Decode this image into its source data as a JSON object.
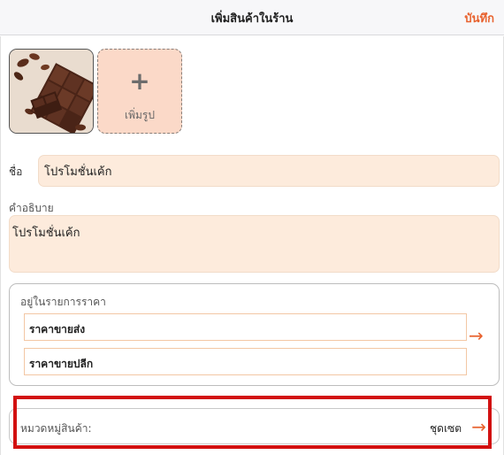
{
  "header": {
    "title": "เพิ่มสินค้าในร้าน",
    "save_label": "บันทึก"
  },
  "photos": {
    "add_label": "เพิ่มรูป",
    "add_symbol": "+"
  },
  "form": {
    "name_label": "ชื่อ",
    "name_value": "โปรโมชั่นเค้ก",
    "description_label": "คำอธิบาย",
    "description_value": "โปรโมชั่นเค้ก"
  },
  "price_list": {
    "title": "อยู่ในรายการราคา",
    "items": [
      {
        "label": "ราคาขายส่ง"
      },
      {
        "label": "ราคาขายปลีก"
      }
    ]
  },
  "category": {
    "label": "หมวดหมู่สินค้า:",
    "value": "ชุดเซต"
  },
  "icons": {
    "arrow": "arrow-right-icon",
    "plus": "plus-icon"
  },
  "colors": {
    "accent": "#e8622e",
    "field_bg": "#fdebdc",
    "add_photo_bg": "#fbd9c8",
    "highlight": "#d21010"
  }
}
